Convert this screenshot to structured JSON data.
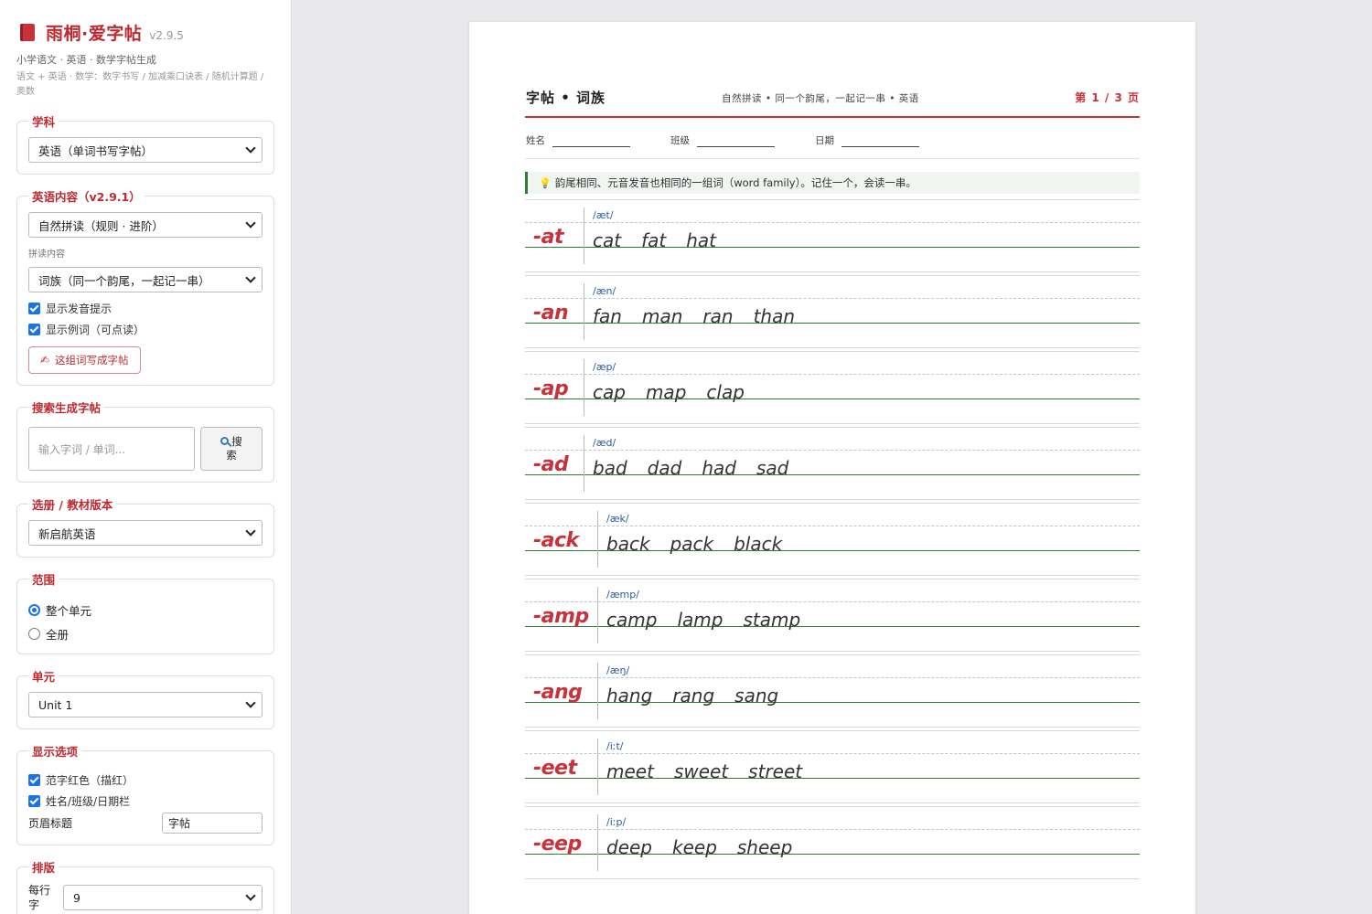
{
  "app": {
    "title": "雨桐·爱字帖",
    "version": "v2.9.5",
    "subtitle": "小学语文 · 英语 · 数学字帖生成",
    "description": "语文 + 英语 · 数学：数字书写 / 加减乘口诀表 / 随机计算题 / 奥数"
  },
  "sidebar": {
    "subject": {
      "legend": "学科",
      "selected": "英语（单词书写字帖）"
    },
    "english_content": {
      "legend": "英语内容（v2.9.1）",
      "mode_selected": "自然拼读（规则 · 进阶）",
      "phonics_label": "拼读内容",
      "phonics_selected": "词族（同一个韵尾，一起记一串）",
      "show_pron": "显示发音提示",
      "show_examples": "显示例词（可点读）",
      "write_button": "这组词写成字帖"
    },
    "search": {
      "legend": "搜索生成字帖",
      "placeholder": "输入字词 / 单词...",
      "button_line1": "搜",
      "button_line2": "索"
    },
    "textbook": {
      "legend": "选册 / 教材版本",
      "selected": "新启航英语"
    },
    "range": {
      "legend": "范围",
      "opt1": "整个单元",
      "opt2": "全册"
    },
    "unit": {
      "legend": "单元",
      "selected": "Unit 1"
    },
    "display": {
      "legend": "显示选项",
      "red_sample": "范字红色（描红）",
      "name_bar": "姓名/班级/日期栏",
      "header_title_label": "页眉标题",
      "header_title_value": "字帖"
    },
    "layout": {
      "legend": "排版",
      "per_row_label": "每行字",
      "per_row_value": "9"
    }
  },
  "sheet": {
    "title": "字帖 • 词族",
    "subtitle": "自然拼读 • 同一个韵尾，一起记一串 • 英语",
    "page": "第 1 / 3 页",
    "name_label": "姓名",
    "class_label": "班级",
    "date_label": "日期",
    "tip": "韵尾相同、元音发音也相同的一组词（word family）。记住一个，会读一串。",
    "families": [
      {
        "rime": "-at",
        "ipa": "/æt/",
        "words": [
          "cat",
          "fat",
          "hat"
        ]
      },
      {
        "rime": "-an",
        "ipa": "/æn/",
        "words": [
          "fan",
          "man",
          "ran",
          "than"
        ]
      },
      {
        "rime": "-ap",
        "ipa": "/æp/",
        "words": [
          "cap",
          "map",
          "clap"
        ]
      },
      {
        "rime": "-ad",
        "ipa": "/æd/",
        "words": [
          "bad",
          "dad",
          "had",
          "sad"
        ]
      },
      {
        "rime": "-ack",
        "ipa": "/æk/",
        "words": [
          "back",
          "pack",
          "black"
        ]
      },
      {
        "rime": "-amp",
        "ipa": "/æmp/",
        "words": [
          "camp",
          "lamp",
          "stamp"
        ]
      },
      {
        "rime": "-ang",
        "ipa": "/æŋ/",
        "words": [
          "hang",
          "rang",
          "sang"
        ]
      },
      {
        "rime": "-eet",
        "ipa": "/iːt/",
        "words": [
          "meet",
          "sweet",
          "street"
        ]
      },
      {
        "rime": "-eep",
        "ipa": "/iːp/",
        "words": [
          "deep",
          "keep",
          "sheep"
        ]
      }
    ]
  },
  "colors": {
    "accent": "#c8323c",
    "baseline": "#2e7d32",
    "ipa": "#2c5aa0"
  }
}
